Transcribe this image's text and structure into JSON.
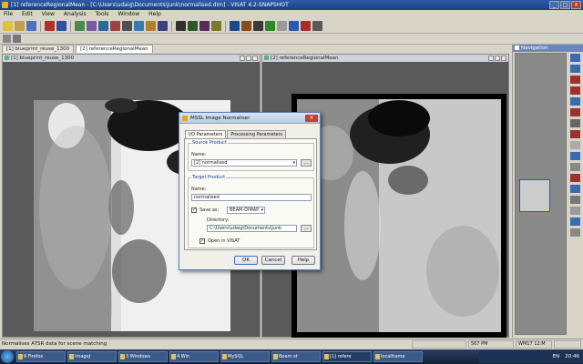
{
  "window": {
    "title": "[1] referenceRegionalMean - [C:\\Users\\udaig\\Documents\\junk\\normalised.dim] - VISAT 4.2-SNAPSHOT"
  },
  "menu": [
    "File",
    "Edit",
    "View",
    "Analysis",
    "Tools",
    "Window",
    "Help"
  ],
  "doc_tabs": [
    "[1] blueprint_reuse_1300",
    "[2] referenceRegionalMean"
  ],
  "left_view": {
    "title": "[1] blueprint_reuse_1300"
  },
  "right_view": {
    "title": "[2] referenceRegionalMean"
  },
  "nav": {
    "title": "Navigation"
  },
  "dialog": {
    "title": "MSSL Image Normaliser",
    "tabs": [
      "I/O Parameters",
      "Processing Parameters"
    ],
    "source_group": "Source Product",
    "source_name_label": "Name:",
    "source_name_value": "[2] normalised",
    "target_group": "Target Product",
    "target_name_label": "Name:",
    "target_name_value": "normalised",
    "save_as_label": "Save as:",
    "save_as_format": "BEAM-DIMAP",
    "directory_label": "Directory:",
    "directory_value": "C:\\Users\\udaig\\Documents\\junk",
    "open_label": "Open in VISAT",
    "buttons": {
      "ok": "OK",
      "cancel": "Cancel",
      "help": "Help"
    }
  },
  "status": {
    "message": "Normalises ATSR data for scene matching",
    "cell1": "",
    "cell2": "567 PM",
    "cell3": "WM17 12:M",
    "cell4": ""
  },
  "taskbar": {
    "tasks": [
      "6 Firefox",
      "ImageJ",
      "3 Windows",
      "4 Win",
      "MySQL",
      "Beam st",
      "[1] refere",
      "localframe"
    ],
    "tray_lang": "EN",
    "tray_time": "20:46"
  },
  "colors": {
    "title_bar": "#1c3f84",
    "dialog_border": "#5d7fb6",
    "nav_header": "#6b86b8"
  }
}
